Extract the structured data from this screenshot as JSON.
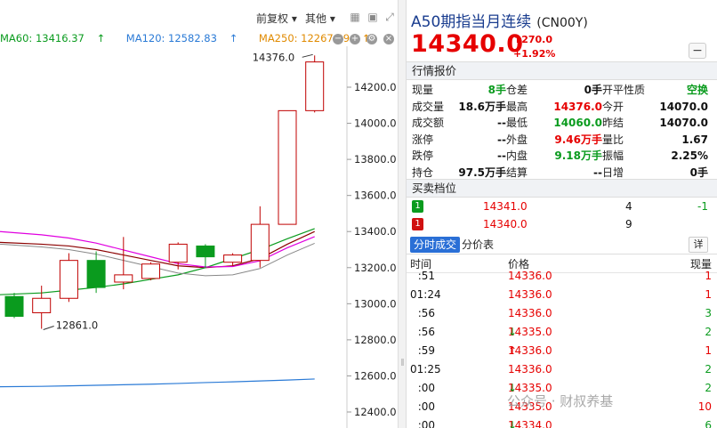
{
  "toolbar": {
    "adjust_label": "前复权",
    "other_label": "其他",
    "ma60": "MA60: 13416.37",
    "ma120": "MA120: 12582.83",
    "ma250": "MA250: 12267.09",
    "arrow": "↑"
  },
  "chart": {
    "y_ticks": [
      "14200.0",
      "14000.0",
      "13800.0",
      "13600.0",
      "13400.0",
      "13200.0",
      "13000.0",
      "12800.0",
      "12600.0",
      "12400.0"
    ],
    "high_label": "14376.0",
    "low_label": "12861.0",
    "colors": {
      "up": "#c00000",
      "down": "#0a9b1e",
      "ma60": "#0a9b1e",
      "ma120": "#2a7ad6",
      "ma250": "#e08a00"
    }
  },
  "chart_data": {
    "type": "candlestick",
    "y_axis_ticks": [
      14200,
      14000,
      13800,
      13600,
      13400,
      13200,
      13000,
      12800,
      12600,
      12400
    ],
    "ylim": [
      12400,
      14400
    ],
    "candles": [
      {
        "open": 13040,
        "close": 12930,
        "high": 13060,
        "low": 12920
      },
      {
        "open": 12950,
        "close": 13030,
        "high": 13100,
        "low": 12861
      },
      {
        "open": 13030,
        "close": 13240,
        "high": 13280,
        "low": 13010
      },
      {
        "open": 13240,
        "close": 13090,
        "high": 13290,
        "low": 13060
      },
      {
        "open": 13120,
        "close": 13160,
        "high": 13370,
        "low": 13080
      },
      {
        "open": 13140,
        "close": 13220,
        "high": 13230,
        "low": 13130
      },
      {
        "open": 13230,
        "close": 13330,
        "high": 13340,
        "low": 13190
      },
      {
        "open": 13320,
        "close": 13260,
        "high": 13330,
        "low": 13200
      },
      {
        "open": 13230,
        "close": 13270,
        "high": 13280,
        "low": 13210
      },
      {
        "open": 13240,
        "close": 13440,
        "high": 13540,
        "low": 13200
      },
      {
        "open": 13440,
        "close": 14070,
        "high": 14070,
        "low": 13440
      },
      {
        "open": 14070,
        "close": 14340,
        "high": 14376,
        "low": 14060
      }
    ],
    "ma60": [
      13050,
      13060,
      13075,
      13090,
      13110,
      13135,
      13160,
      13200,
      13250,
      13300,
      13360,
      13416.37
    ],
    "ma120": [
      12540,
      12542,
      12545,
      12548,
      12551,
      12554,
      12558,
      12563,
      12567,
      12572,
      12577,
      12582.83
    ],
    "ma250": [
      13340,
      13330,
      13320,
      13300,
      13270,
      13240,
      13210,
      13200,
      13210,
      13250,
      13330,
      13400
    ]
  },
  "quote": {
    "title": "A50期指当月连续",
    "code": "(CN00Y)",
    "price": "14340.0",
    "change": "270.0",
    "change_pct": "+1.92%",
    "up_arrow": "↑",
    "minus": "−",
    "section_quote": "行情报价",
    "section_orderbook": "买卖档位",
    "stats": [
      [
        "现量",
        "8手",
        "仓差",
        "0手",
        "开平性质",
        "空换"
      ],
      [
        "成交量",
        "18.6万手",
        "最高",
        "14376.0",
        "今开",
        "14070.0"
      ],
      [
        "成交额",
        "--",
        "最低",
        "14060.0",
        "昨结",
        "14070.0"
      ],
      [
        "涨停",
        "--",
        "外盘",
        "9.46万手",
        "量比",
        "1.67"
      ],
      [
        "跌停",
        "--",
        "内盘",
        "9.18万手",
        "振幅",
        "2.25%"
      ],
      [
        "持仓",
        "97.5万手",
        "结算",
        "--",
        "日增",
        "0手"
      ]
    ],
    "orderbook": [
      {
        "tag": "1",
        "price": "14341.0",
        "vol": "4",
        "chg": "-1"
      },
      {
        "tag": "1",
        "price": "14340.0",
        "vol": "9",
        "chg": ""
      }
    ],
    "tab_ticks": "分时成交",
    "tab_price": "分价表",
    "detail": "详",
    "tick_headers": [
      "时间",
      "价格",
      "现量"
    ],
    "ticks": [
      {
        "time": ":51",
        "price": "14336.0",
        "dir": "",
        "vol": "1"
      },
      {
        "time": "01:24",
        "price": "14336.0",
        "dir": "",
        "vol": "1"
      },
      {
        "time": ":56",
        "price": "14336.0",
        "dir": "",
        "vol": "3"
      },
      {
        "time": ":56",
        "price": "14335.0",
        "dir": "↓",
        "vol": "2"
      },
      {
        "time": ":59",
        "price": "14336.0",
        "dir": "↑",
        "vol": "1"
      },
      {
        "time": "01:25",
        "price": "14336.0",
        "dir": "",
        "vol": "2"
      },
      {
        "time": ":00",
        "price": "14335.0",
        "dir": "↓",
        "vol": "2"
      },
      {
        "time": ":00",
        "price": "14335.0",
        "dir": "",
        "vol": "10"
      },
      {
        "time": ":00",
        "price": "14334.0",
        "dir": "↓",
        "vol": "6"
      }
    ],
    "watermark": "公众号 · 财叔养基"
  }
}
